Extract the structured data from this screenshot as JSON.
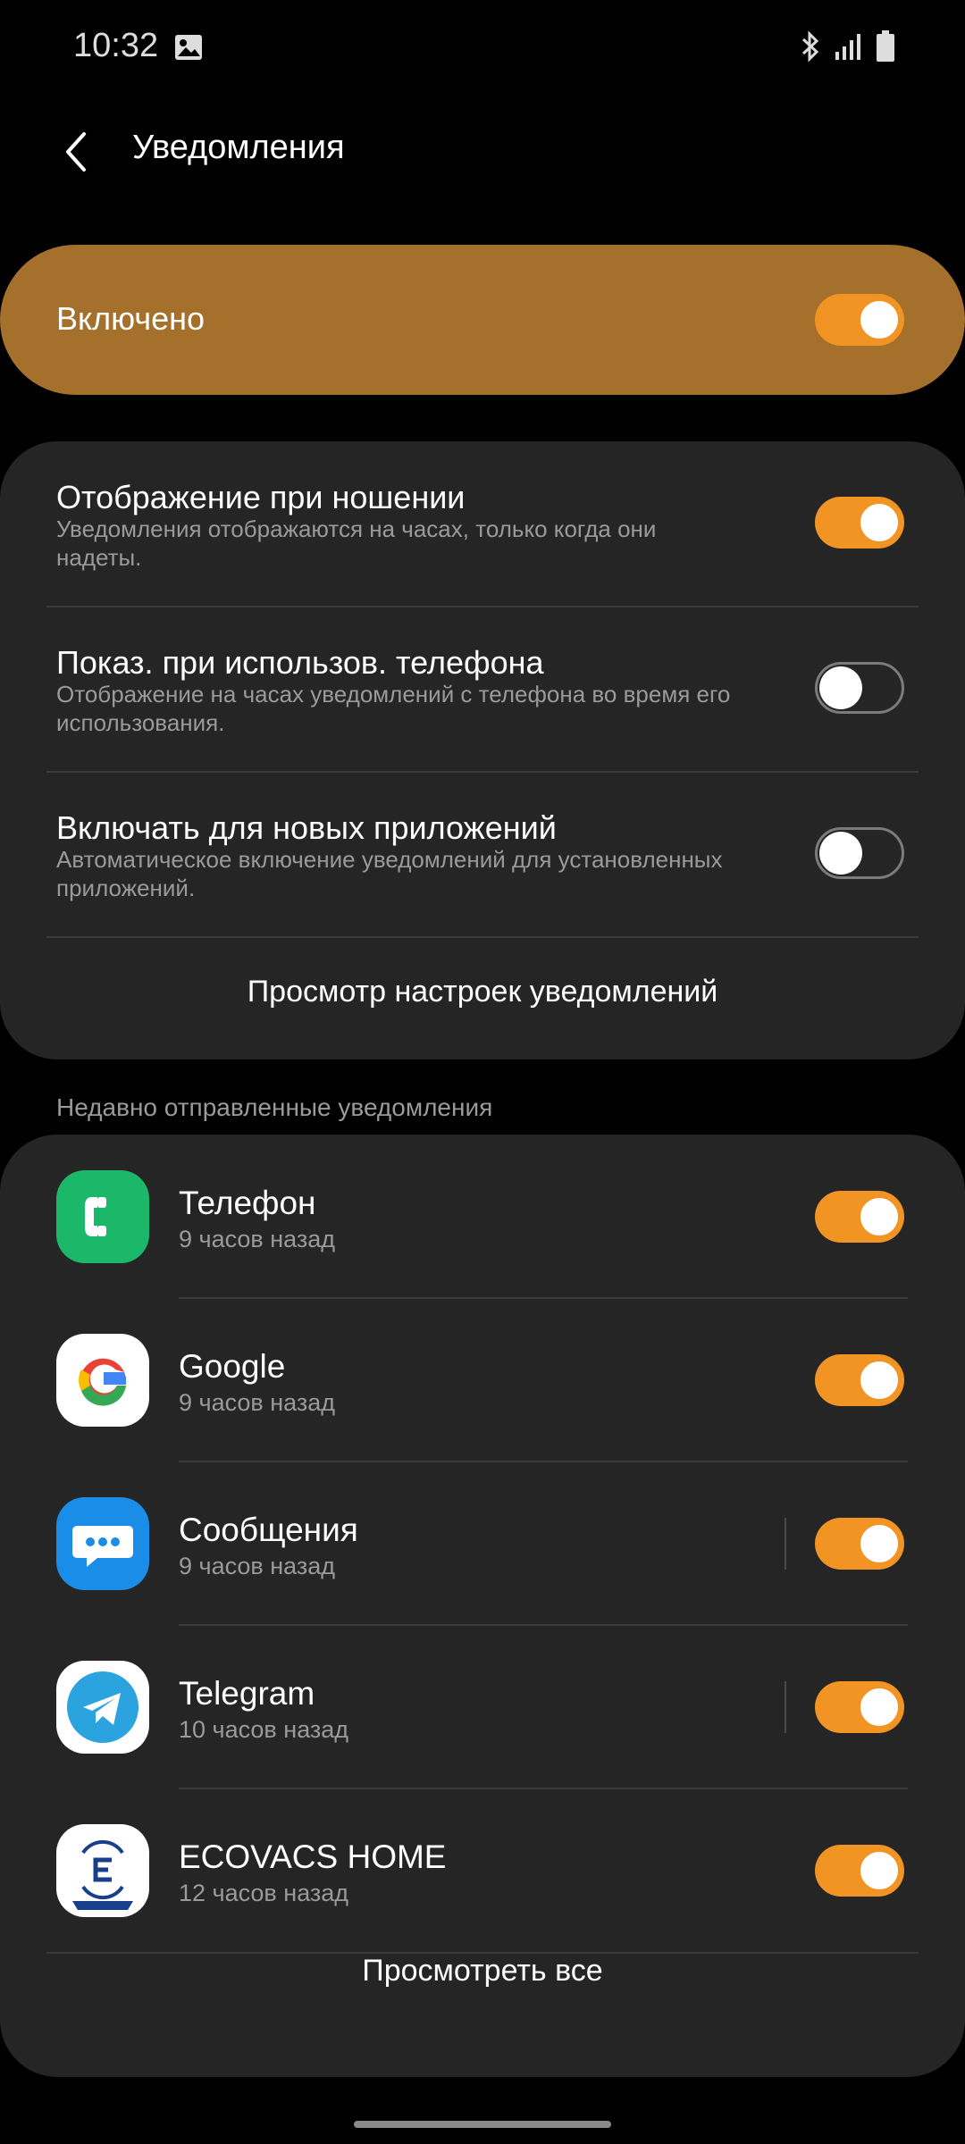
{
  "status_bar": {
    "time": "10:32",
    "icons": [
      "gallery-icon",
      "bluetooth-icon",
      "signal-icon",
      "battery-icon"
    ]
  },
  "header": {
    "back_icon": "chevron-left-icon",
    "title": "Уведомления"
  },
  "master": {
    "label": "Включено",
    "enabled": true
  },
  "settings": {
    "items": [
      {
        "title": "Отображение при ношении",
        "description": "Уведомления отображаются на часах, только когда они надеты.",
        "enabled": true
      },
      {
        "title": "Показ. при использов. телефона",
        "description": "Отображение на часах уведомлений с телефона во время его использования.",
        "enabled": false
      },
      {
        "title": "Включать для новых приложений",
        "description": "Автоматическое включение уведомлений для установленных приложений.",
        "enabled": false
      }
    ],
    "link_label": "Просмотр настроек уведомлений"
  },
  "recent": {
    "section_label": "Недавно отправленные уведомления",
    "apps": [
      {
        "name": "Телефон",
        "time": "9 часов назад",
        "icon": "phone-app-icon",
        "enabled": true
      },
      {
        "name": "Google",
        "time": "9 часов назад",
        "icon": "google-app-icon",
        "enabled": true
      },
      {
        "name": "Сообщения",
        "time": "9 часов назад",
        "icon": "messages-app-icon",
        "enabled": true
      },
      {
        "name": "Telegram",
        "time": "10 часов назад",
        "icon": "telegram-app-icon",
        "enabled": true
      },
      {
        "name": "ECOVACS HOME",
        "time": "12 часов назад",
        "icon": "ecovacs-app-icon",
        "enabled": true
      }
    ],
    "view_all_label": "Просмотреть все"
  },
  "colors": {
    "accent": "#f29423",
    "master_card": "#a5702b",
    "card": "#252525",
    "background": "#000000"
  }
}
